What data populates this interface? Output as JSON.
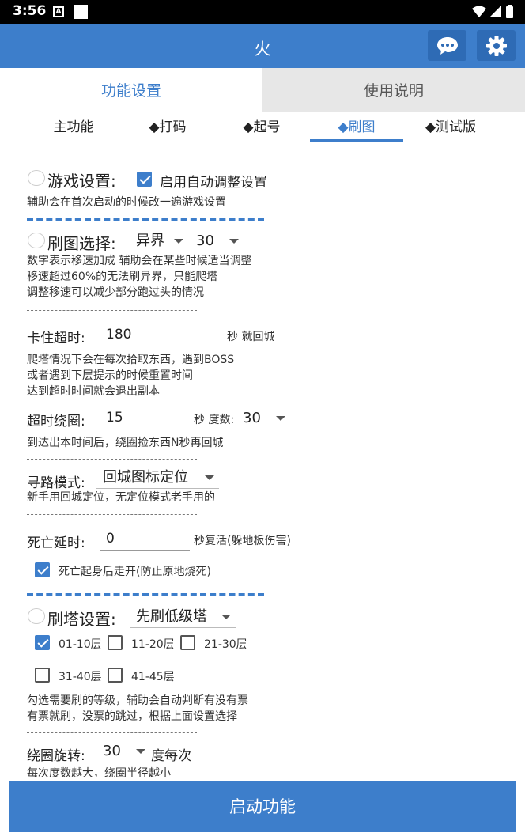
{
  "status": {
    "time": "3:56",
    "a_badge": "A"
  },
  "app": {
    "title": "火"
  },
  "tabs": [
    {
      "label": "功能设置"
    },
    {
      "label": "使用说明"
    }
  ],
  "subtabs": [
    {
      "label": "主功能"
    },
    {
      "label": "◆打码"
    },
    {
      "label": "◆起号"
    },
    {
      "label": "◆刷图"
    },
    {
      "label": "◆测试版"
    }
  ],
  "game": {
    "title": "游戏设置:",
    "auto_adjust": {
      "label": "启用自动调整设置",
      "checked": true
    },
    "desc": "辅助会在首次启动的时候改一遍游戏设置"
  },
  "brush": {
    "title": "刷图选择:",
    "map_select": "异界",
    "speed_select": "30",
    "desc1": "数字表示移速加成 辅助会在某些时候适当调整",
    "desc2": "移速超过60%的无法刷异界，只能爬塔",
    "desc3": "调整移速可以减少部分跑过头的情况"
  },
  "stuck": {
    "label": "卡住超时:",
    "value": "180",
    "suffix": "秒 就回城",
    "desc1": "爬塔情况下会在每次拾取东西，遇到BOSS",
    "desc2": "或者遇到下层提示的时候重置时间",
    "desc3": "达到超时时间就会退出副本"
  },
  "circle": {
    "label": "超时绕圈:",
    "value": "15",
    "suffix": "秒 度数:",
    "degree": "30",
    "desc": "到达出本时间后，绕圈捡东西N秒再回城"
  },
  "path": {
    "label": "寻路模式:",
    "mode": "回城图标定位",
    "desc": "新手用回城定位，无定位模式老手用的"
  },
  "death": {
    "label": "死亡延时:",
    "value": "0",
    "suffix": "秒复活(躲地板伤害)",
    "walk_away": {
      "label": "死亡起身后走开(防止原地烧死)",
      "checked": true
    }
  },
  "tower": {
    "title": "刷塔设置:",
    "mode": "先刷低级塔",
    "floors": [
      {
        "label": "01-10层",
        "checked": true
      },
      {
        "label": "11-20层",
        "checked": false
      },
      {
        "label": "21-30层",
        "checked": false
      },
      {
        "label": "31-40层",
        "checked": false
      },
      {
        "label": "41-45层",
        "checked": false
      }
    ],
    "desc1": "勾选需要刷的等级，辅助会自动判断有没有票",
    "desc2": "有票就刷，没票的跳过，根据上面设置选择"
  },
  "rotate": {
    "label": "绕圈旋转:",
    "value": "30",
    "suffix": "度每次",
    "desc": "每次度数越大，绕圈半径越小"
  },
  "start_button": "启动功能",
  "colors": {
    "primary": "#3d7ecb",
    "primary_dark": "#2e6bb5",
    "tab_inactive": "#e7e7e7"
  },
  "icons": [
    "chat-icon",
    "gear-icon",
    "wifi-icon",
    "signal-icon",
    "battery-icon",
    "chevron-down-icon"
  ]
}
